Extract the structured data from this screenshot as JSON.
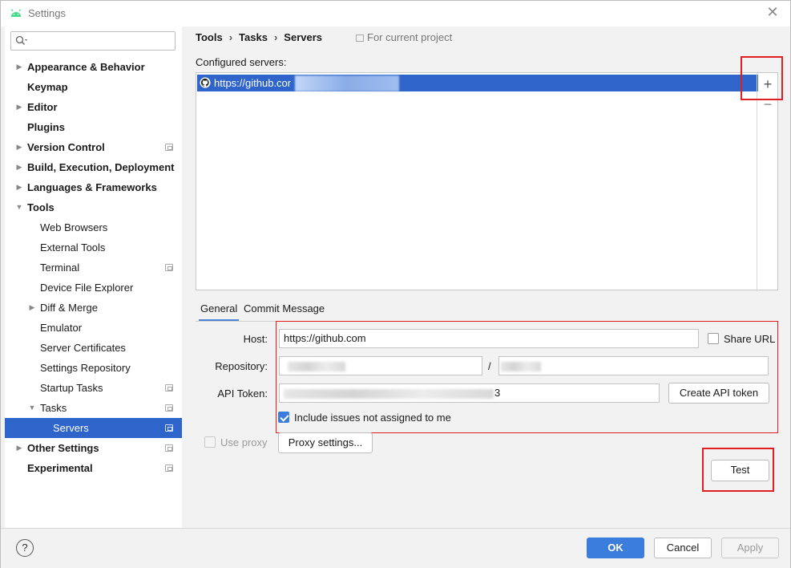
{
  "window": {
    "title": "Settings",
    "icons": {
      "app": "android-icon",
      "close": "close-icon"
    }
  },
  "sidebar": {
    "search_placeholder": "",
    "items": [
      {
        "label": "Appearance & Behavior",
        "bold": true,
        "arrow": "right",
        "indent": 0,
        "project": false
      },
      {
        "label": "Keymap",
        "bold": true,
        "arrow": "",
        "indent": 0,
        "project": false
      },
      {
        "label": "Editor",
        "bold": true,
        "arrow": "right",
        "indent": 0,
        "project": false
      },
      {
        "label": "Plugins",
        "bold": true,
        "arrow": "",
        "indent": 0,
        "project": false
      },
      {
        "label": "Version Control",
        "bold": true,
        "arrow": "right",
        "indent": 0,
        "project": true
      },
      {
        "label": "Build, Execution, Deployment",
        "bold": true,
        "arrow": "right",
        "indent": 0,
        "project": false
      },
      {
        "label": "Languages & Frameworks",
        "bold": true,
        "arrow": "right",
        "indent": 0,
        "project": false
      },
      {
        "label": "Tools",
        "bold": true,
        "arrow": "down",
        "indent": 0,
        "project": false
      },
      {
        "label": "Web Browsers",
        "bold": false,
        "arrow": "",
        "indent": 1,
        "project": false
      },
      {
        "label": "External Tools",
        "bold": false,
        "arrow": "",
        "indent": 1,
        "project": false
      },
      {
        "label": "Terminal",
        "bold": false,
        "arrow": "",
        "indent": 1,
        "project": true
      },
      {
        "label": "Device File Explorer",
        "bold": false,
        "arrow": "",
        "indent": 1,
        "project": false
      },
      {
        "label": "Diff & Merge",
        "bold": false,
        "arrow": "right",
        "indent": 1,
        "project": false
      },
      {
        "label": "Emulator",
        "bold": false,
        "arrow": "",
        "indent": 1,
        "project": false
      },
      {
        "label": "Server Certificates",
        "bold": false,
        "arrow": "",
        "indent": 1,
        "project": false
      },
      {
        "label": "Settings Repository",
        "bold": false,
        "arrow": "",
        "indent": 1,
        "project": false
      },
      {
        "label": "Startup Tasks",
        "bold": false,
        "arrow": "",
        "indent": 1,
        "project": true
      },
      {
        "label": "Tasks",
        "bold": false,
        "arrow": "down",
        "indent": 1,
        "project": true
      },
      {
        "label": "Servers",
        "bold": false,
        "arrow": "",
        "indent": 2,
        "project": true,
        "selected": true
      },
      {
        "label": "Other Settings",
        "bold": true,
        "arrow": "right",
        "indent": 0,
        "project": true
      },
      {
        "label": "Experimental",
        "bold": true,
        "arrow": "",
        "indent": 0,
        "project": true
      }
    ]
  },
  "breadcrumb": {
    "items": [
      "Tools",
      "Tasks",
      "Servers"
    ],
    "separator": "›",
    "scope": "For current project"
  },
  "servers": {
    "label": "Configured servers:",
    "list": [
      {
        "url": "https://github.cor",
        "icon": "github-icon"
      }
    ],
    "add": "+",
    "remove": "−"
  },
  "tabs": [
    "General",
    "Commit Message"
  ],
  "form": {
    "host_label": "Host:",
    "host_value": "https://github.com",
    "share_url_label": "Share URL",
    "share_url_checked": false,
    "repository_label": "Repository:",
    "repo_separator": "/",
    "api_token_label": "API Token:",
    "api_token_suffix": "3",
    "create_token_label": "Create API token",
    "include_issues_label": "Include issues not assigned to me",
    "include_issues_checked": true,
    "use_proxy_label": "Use proxy",
    "proxy_settings_label": "Proxy settings...",
    "test_label": "Test"
  },
  "footer": {
    "help": "?",
    "ok": "OK",
    "cancel": "Cancel",
    "apply": "Apply"
  },
  "colors": {
    "accent": "#2f65ca",
    "primary_button": "#3b7ddd",
    "annotation": "#e02020"
  }
}
